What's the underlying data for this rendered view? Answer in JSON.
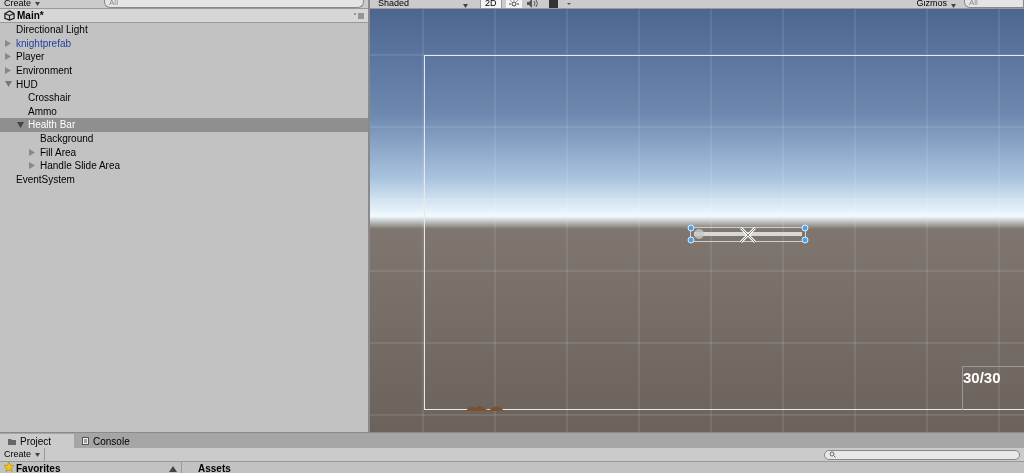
{
  "hierarchy": {
    "create_button": "Create",
    "search": {
      "placeholder": "All"
    },
    "scene_name": "Main*",
    "items": [
      {
        "label": "Directional Light",
        "kind": "object",
        "selected": false
      },
      {
        "label": "knightprefab",
        "kind": "prefab",
        "expanded": false,
        "selected": false
      },
      {
        "label": "Player",
        "kind": "object",
        "expanded": false,
        "selected": false
      },
      {
        "label": "Environment",
        "kind": "object",
        "expanded": false,
        "selected": false
      },
      {
        "label": "HUD",
        "kind": "object",
        "expanded": true,
        "selected": false,
        "children": [
          {
            "label": "Crosshair",
            "kind": "object",
            "selected": false
          },
          {
            "label": "Ammo",
            "kind": "object",
            "selected": false
          },
          {
            "label": "Health Bar",
            "kind": "object",
            "expanded": true,
            "selected": true,
            "children": [
              {
                "label": "Background",
                "kind": "object",
                "selected": false
              },
              {
                "label": "Fill Area",
                "kind": "object",
                "expanded": false,
                "selected": false
              },
              {
                "label": "Handle Slide Area",
                "kind": "object",
                "expanded": false,
                "selected": false
              }
            ]
          }
        ]
      },
      {
        "label": "EventSystem",
        "kind": "object",
        "selected": false
      }
    ]
  },
  "scene_toolbar": {
    "shading": "Shaded",
    "mode_2d": {
      "label": "2D",
      "on": true
    },
    "lighting_on": true,
    "gizmos": "Gizmos",
    "search": {
      "placeholder": "All"
    }
  },
  "scene": {
    "health_slider": {
      "level": 0.05
    },
    "ammo_text": "30/30"
  },
  "bottom_panel": {
    "tabs": [
      {
        "label": "Project",
        "selected": true
      },
      {
        "label": "Console",
        "selected": false
      }
    ],
    "create_button": "Create",
    "favorites": "Favorites",
    "assets": "Assets"
  }
}
